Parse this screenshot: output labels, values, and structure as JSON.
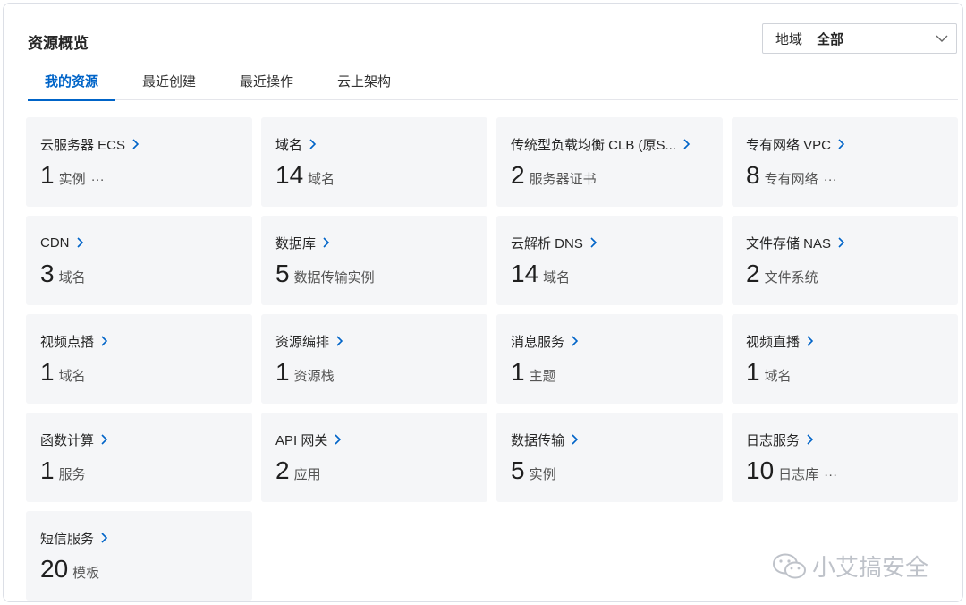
{
  "header": {
    "title": "资源概览",
    "region": {
      "label": "地域",
      "value": "全部"
    }
  },
  "tabs": [
    {
      "label": "我的资源",
      "active": true
    },
    {
      "label": "最近创建",
      "active": false
    },
    {
      "label": "最近操作",
      "active": false
    },
    {
      "label": "云上架构",
      "active": false
    }
  ],
  "cards": [
    {
      "name": "云服务器 ECS",
      "count": "1",
      "unit": "实例",
      "more": "···"
    },
    {
      "name": "域名",
      "count": "14",
      "unit": "域名",
      "more": ""
    },
    {
      "name": "传统型负载均衡 CLB (原S...",
      "count": "2",
      "unit": "服务器证书",
      "more": ""
    },
    {
      "name": "专有网络 VPC",
      "count": "8",
      "unit": "专有网络",
      "more": "···"
    },
    {
      "name": "CDN",
      "count": "3",
      "unit": "域名",
      "more": ""
    },
    {
      "name": "数据库",
      "count": "5",
      "unit": "数据传输实例",
      "more": ""
    },
    {
      "name": "云解析 DNS",
      "count": "14",
      "unit": "域名",
      "more": ""
    },
    {
      "name": "文件存储 NAS",
      "count": "2",
      "unit": "文件系统",
      "more": ""
    },
    {
      "name": "视频点播",
      "count": "1",
      "unit": "域名",
      "more": ""
    },
    {
      "name": "资源编排",
      "count": "1",
      "unit": "资源栈",
      "more": ""
    },
    {
      "name": "消息服务",
      "count": "1",
      "unit": "主题",
      "more": ""
    },
    {
      "name": "视频直播",
      "count": "1",
      "unit": "域名",
      "more": ""
    },
    {
      "name": "函数计算",
      "count": "1",
      "unit": "服务",
      "more": ""
    },
    {
      "name": "API 网关",
      "count": "2",
      "unit": "应用",
      "more": ""
    },
    {
      "name": "数据传输",
      "count": "5",
      "unit": "实例",
      "more": ""
    },
    {
      "name": "日志服务",
      "count": "10",
      "unit": "日志库",
      "more": "···"
    },
    {
      "name": "短信服务",
      "count": "20",
      "unit": "模板",
      "more": ""
    }
  ],
  "watermark": {
    "text": "小艾搞安全",
    "icon": "wechat-icon"
  },
  "colors": {
    "accent": "#0064c8",
    "card_bg": "#f5f6f8"
  }
}
